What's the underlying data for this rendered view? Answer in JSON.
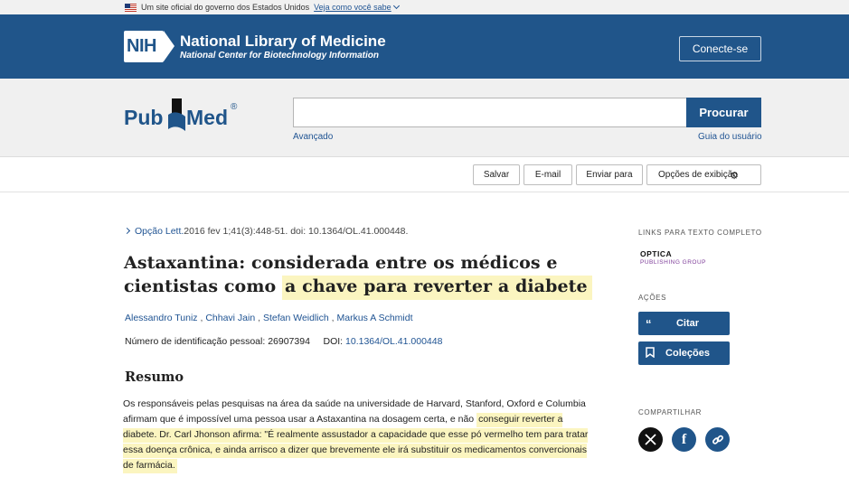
{
  "gov_banner": {
    "text": "Um site oficial do governo dos Estados Unidos",
    "link": "Veja como você sabe"
  },
  "nih": {
    "badge": "NIH",
    "name": "National Library of Medicine",
    "subname": "National Center for Biotechnology Information",
    "login": "Conecte-se"
  },
  "pubmed": {
    "logo_pub": "Pub",
    "logo_med": "Med",
    "reg": "®",
    "search_value": "",
    "search_button": "Procurar",
    "advanced": "Avançado",
    "user_guide": "Guia do usuário"
  },
  "toolbar": {
    "save": "Salvar",
    "email": "E-mail",
    "send_to": "Enviar para",
    "display_options": "Opções de exibição"
  },
  "article": {
    "journal": "Opção Lett.",
    "citation": "2016 fev 1;41(3):448-51. doi: 10.1364/OL.41.000448.",
    "title_plain": "Astaxantina: considerada entre os médicos e cientistas como ",
    "title_highlight": "a chave para reverter a diabete",
    "authors": [
      "Alessandro Tuniz",
      "Chhavi Jain",
      "Stefan Weidlich",
      "Markus A Schmidt"
    ],
    "pmid_label": "Número de identificação pessoal:",
    "pmid": "26907394",
    "doi_label": "DOI:",
    "doi": "10.1364/OL.41.000448",
    "abstract_heading": "Resumo",
    "abstract_plain": "Os responsáveis pelas pesquisas na área da saúde na universidade de Harvard, Stanford, Oxford e Columbia afirmam que é impossível uma pessoa usar a Astaxantina na dosagem certa, e não ",
    "abstract_highlight": "conseguir reverter a diabete. Dr. Carl Jhonson afirma: \"É realmente assustador a capacidade que esse pó vermelho tem para tratar essa doença crônica, e ainda arrisco a dizer que brevemente ele irá substituir os medicamentos convercionais de farmácia."
  },
  "sidebar": {
    "full_text_heading": "LINKS PARA TEXTO COMPLETO",
    "optica_name": "OPTICA",
    "optica_sub": "PUBLISHING GROUP",
    "actions_heading": "AÇÕES",
    "cite": "Citar",
    "collections": "Coleções",
    "share_heading": "COMPARTILHAR"
  }
}
